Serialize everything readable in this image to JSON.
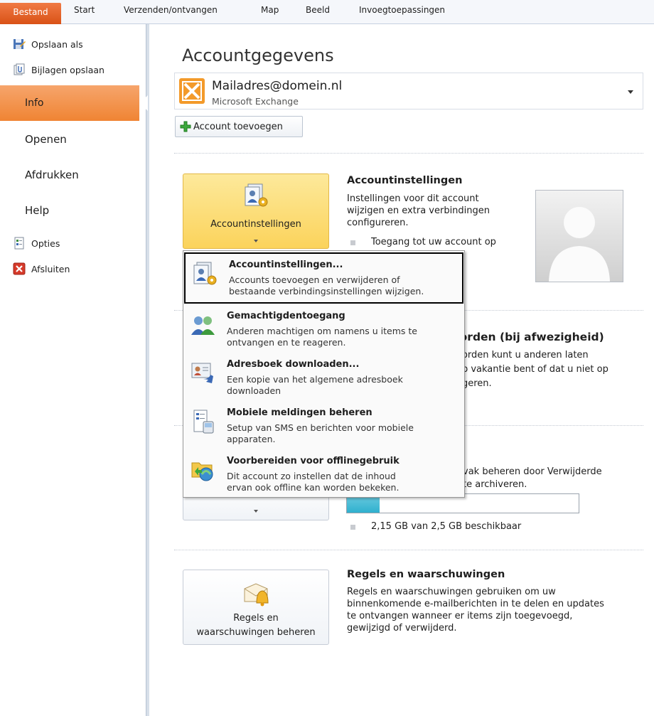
{
  "ribbon": {
    "file_tab": "Bestand",
    "tabs": [
      "Start",
      "Verzenden/ontvangen",
      "Map",
      "Beeld",
      "Invoegtoepassingen"
    ]
  },
  "nav": {
    "save_as": "Opslaan als",
    "save_attachments": "Bijlagen opslaan",
    "info": "Info",
    "open": "Openen",
    "print": "Afdrukken",
    "help": "Help",
    "options": "Opties",
    "exit": "Afsluiten"
  },
  "page": {
    "title": "Accountgegevens",
    "account_email": "Mailadres@domein.nl",
    "account_type": "Microsoft Exchange",
    "add_account": "Account toevoegen"
  },
  "account_settings": {
    "button_label": "Accountinstellingen",
    "title": "Accountinstellingen",
    "text": [
      "Instellingen voor dit account",
      "wijzigen en extra verbindingen",
      "configureren."
    ],
    "bullet": "Toegang tot uw account op"
  },
  "auto_reply": {
    "title_partial": "oorden (bij afwezigheid)",
    "text": [
      "oorden kunt u anderen laten",
      "op vakantie bent of dat u niet op",
      "ageren."
    ]
  },
  "mailbox": {
    "text": [
      "vak beheren door Verwijderde",
      "te archiveren."
    ],
    "usage": "2,15 GB van 2,5 GB beschikbaar",
    "used_fraction": 0.14
  },
  "rules": {
    "button_label_line1": "Regels en",
    "button_label_line2": "waarschuwingen beheren",
    "title": "Regels en waarschuwingen",
    "text": [
      "Regels en waarschuwingen gebruiken om uw",
      "binnenkomende e-mailberichten in te delen en updates",
      "te ontvangen wanneer er items zijn toegevoegd,",
      "gewijzigd of verwijderd."
    ]
  },
  "menu": {
    "items": [
      {
        "title": "Accountinstellingen...",
        "desc": [
          "Accounts toevoegen en verwijderen of",
          "bestaande verbindingsinstellingen wijzigen."
        ]
      },
      {
        "title": "Gemachtigdentoegang",
        "desc": [
          "Anderen machtigen om namens u items te",
          "ontvangen en te reageren."
        ]
      },
      {
        "title": "Adresboek downloaden...",
        "desc": [
          "Een kopie van het algemene adresboek",
          "downloaden"
        ]
      },
      {
        "title": "Mobiele meldingen beheren",
        "desc": [
          "Setup van SMS en berichten voor mobiele",
          "apparaten."
        ]
      },
      {
        "title": "Voorbereiden voor offlinegebruik",
        "desc": [
          "Dit account zo instellen dat de inhoud",
          "ervan ook offline kan worden bekeken."
        ]
      }
    ]
  },
  "colors": {
    "file_tab": "#e0611f",
    "nav_selected": "#f4923f",
    "button_active": "#fbd35b",
    "progress": "#2fb0ce"
  }
}
